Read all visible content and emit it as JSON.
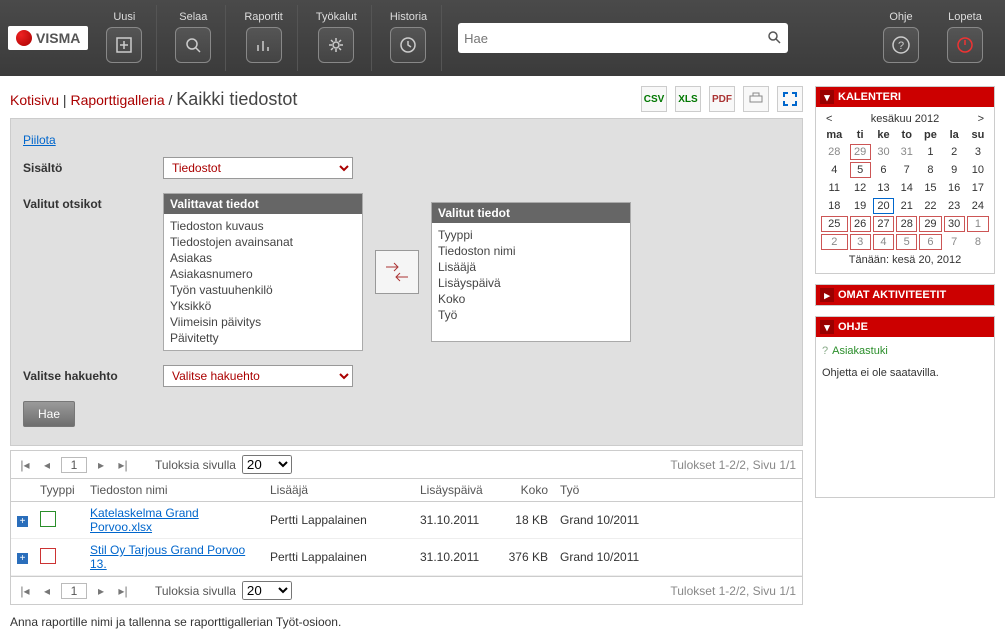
{
  "brand": "VISMA",
  "nav": {
    "uusi": "Uusi",
    "selaa": "Selaa",
    "raportit": "Raportit",
    "tyokalut": "Työkalut",
    "historia": "Historia",
    "ohje": "Ohje",
    "lopeta": "Lopeta"
  },
  "search": {
    "placeholder": "Hae"
  },
  "crumbs": {
    "home": "Kotisivu",
    "gallery": "Raporttigalleria",
    "current": "Kaikki tiedostot",
    "sep": " | ",
    "slash": " / "
  },
  "export": {
    "csv": "CSV",
    "xls": "XLS",
    "pdf": "PDF"
  },
  "panel": {
    "hide": "Piilota",
    "content_label": "Sisältö",
    "content_value": "Tiedostot",
    "titles_label": "Valitut otsikot",
    "avail_hdr": "Valittavat tiedot",
    "sel_hdr": "Valitut tiedot",
    "available": [
      "Tiedoston kuvaus",
      "Tiedostojen avainsanat",
      "Asiakas",
      "Asiakasnumero",
      "Työn vastuuhenkilö",
      "Yksikkö",
      "Viimeisin päivitys",
      "Päivitetty"
    ],
    "selected": [
      "Tyyppi",
      "Tiedoston nimi",
      "Lisääjä",
      "Lisäyspäivä",
      "Koko",
      "Työ"
    ],
    "criteria_label": "Valitse hakuehto",
    "criteria_value": "Valitse hakuehto",
    "hae": "Hae"
  },
  "grid": {
    "page": "1",
    "perpage_label": "Tuloksia sivulla",
    "perpage": "20",
    "summary": "Tulokset 1-2/2, Sivu 1/1",
    "cols": {
      "type": "Tyyppi",
      "name": "Tiedoston nimi",
      "adder": "Lisääjä",
      "date": "Lisäyspäivä",
      "size": "Koko",
      "job": "Työ"
    },
    "rows": [
      {
        "ftype": "xls",
        "name": "Katelaskelma Grand Porvoo.xlsx",
        "adder": "Pertti Lappalainen",
        "date": "31.10.2011",
        "size": "18 KB",
        "job": "Grand 10/2011"
      },
      {
        "ftype": "pdf",
        "name": "Stil Oy Tarjous Grand Porvoo 13.",
        "adder": "Pertti Lappalainen",
        "date": "31.10.2011",
        "size": "376 KB",
        "job": "Grand 10/2011"
      }
    ]
  },
  "footnote": "Anna raportille nimi ja tallenna se raporttigallerian Työt-osioon.",
  "calendar": {
    "title": "KALENTERI",
    "month": "kesäkuu 2012",
    "prev": "<",
    "next": ">",
    "dow": [
      "ma",
      "ti",
      "ke",
      "to",
      "pe",
      "la",
      "su"
    ],
    "weeks": [
      [
        {
          "d": "28",
          "c": "other"
        },
        {
          "d": "29",
          "c": "mark other"
        },
        {
          "d": "30",
          "c": "other"
        },
        {
          "d": "31",
          "c": "other"
        },
        {
          "d": "1",
          "c": ""
        },
        {
          "d": "2",
          "c": ""
        },
        {
          "d": "3",
          "c": ""
        }
      ],
      [
        {
          "d": "4",
          "c": ""
        },
        {
          "d": "5",
          "c": "mark"
        },
        {
          "d": "6",
          "c": ""
        },
        {
          "d": "7",
          "c": ""
        },
        {
          "d": "8",
          "c": ""
        },
        {
          "d": "9",
          "c": ""
        },
        {
          "d": "10",
          "c": ""
        }
      ],
      [
        {
          "d": "11",
          "c": ""
        },
        {
          "d": "12",
          "c": ""
        },
        {
          "d": "13",
          "c": ""
        },
        {
          "d": "14",
          "c": ""
        },
        {
          "d": "15",
          "c": ""
        },
        {
          "d": "16",
          "c": ""
        },
        {
          "d": "17",
          "c": ""
        }
      ],
      [
        {
          "d": "18",
          "c": ""
        },
        {
          "d": "19",
          "c": ""
        },
        {
          "d": "20",
          "c": "today"
        },
        {
          "d": "21",
          "c": ""
        },
        {
          "d": "22",
          "c": ""
        },
        {
          "d": "23",
          "c": ""
        },
        {
          "d": "24",
          "c": ""
        }
      ],
      [
        {
          "d": "25",
          "c": "mark"
        },
        {
          "d": "26",
          "c": "mark"
        },
        {
          "d": "27",
          "c": "mark"
        },
        {
          "d": "28",
          "c": "mark"
        },
        {
          "d": "29",
          "c": "mark"
        },
        {
          "d": "30",
          "c": "mark"
        },
        {
          "d": "1",
          "c": "mark other"
        }
      ],
      [
        {
          "d": "2",
          "c": "mark other"
        },
        {
          "d": "3",
          "c": "mark other"
        },
        {
          "d": "4",
          "c": "mark other"
        },
        {
          "d": "5",
          "c": "mark other"
        },
        {
          "d": "6",
          "c": "mark other"
        },
        {
          "d": "7",
          "c": "other"
        },
        {
          "d": "8",
          "c": "other"
        }
      ]
    ],
    "today": "Tänään: kesä 20, 2012"
  },
  "activities": {
    "title": "OMAT AKTIVITEETIT"
  },
  "help": {
    "title": "OHJE",
    "link": "Asiakastuki",
    "text": "Ohjetta ei ole saatavilla."
  }
}
